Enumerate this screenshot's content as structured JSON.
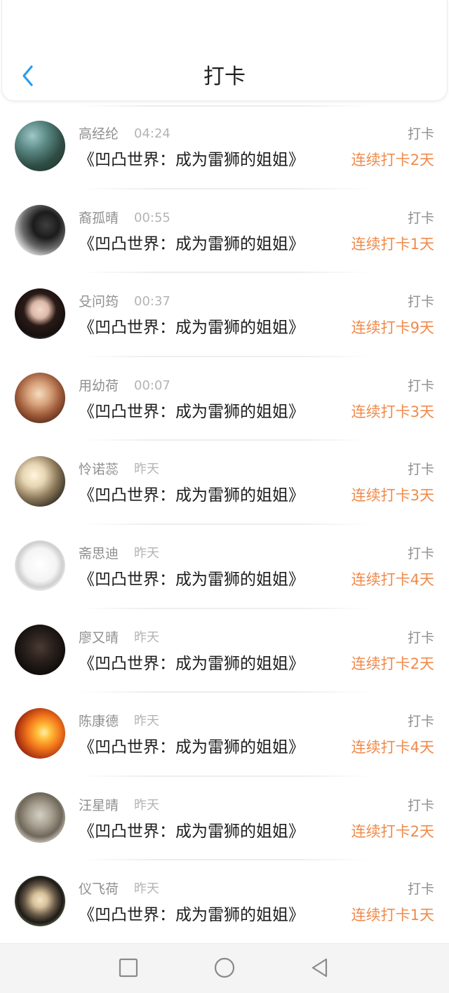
{
  "header": {
    "title": "打卡"
  },
  "checkins": [
    {
      "name": "高经纶",
      "time": "04:24",
      "book": "《凹凸世界：成为雷狮的姐姐》",
      "tag": "打卡",
      "streak": "连续打卡2天"
    },
    {
      "name": "裔孤晴",
      "time": "00:55",
      "book": "《凹凸世界：成为雷狮的姐姐》",
      "tag": "打卡",
      "streak": "连续打卡1天"
    },
    {
      "name": "殳问筠",
      "time": "00:37",
      "book": "《凹凸世界：成为雷狮的姐姐》",
      "tag": "打卡",
      "streak": "连续打卡9天"
    },
    {
      "name": "用幼荷",
      "time": "00:07",
      "book": "《凹凸世界：成为雷狮的姐姐》",
      "tag": "打卡",
      "streak": "连续打卡3天"
    },
    {
      "name": "怜诺蕊",
      "time": "昨天",
      "book": "《凹凸世界：成为雷狮的姐姐》",
      "tag": "打卡",
      "streak": "连续打卡3天"
    },
    {
      "name": "斋思迪",
      "time": "昨天",
      "book": "《凹凸世界：成为雷狮的姐姐》",
      "tag": "打卡",
      "streak": "连续打卡4天"
    },
    {
      "name": "廖又晴",
      "time": "昨天",
      "book": "《凹凸世界：成为雷狮的姐姐》",
      "tag": "打卡",
      "streak": "连续打卡2天"
    },
    {
      "name": "陈康德",
      "time": "昨天",
      "book": "《凹凸世界：成为雷狮的姐姐》",
      "tag": "打卡",
      "streak": "连续打卡4天"
    },
    {
      "name": "汪星晴",
      "time": "昨天",
      "book": "《凹凸世界：成为雷狮的姐姐》",
      "tag": "打卡",
      "streak": "连续打卡2天"
    },
    {
      "name": "仪飞荷",
      "time": "昨天",
      "book": "《凹凸世界：成为雷狮的姐姐》",
      "tag": "打卡",
      "streak": "连续打卡1天"
    }
  ],
  "icons": {
    "back": "chevron-left-icon",
    "recent_apps": "square-icon",
    "home": "circle-icon",
    "nav_back": "triangle-back-icon"
  },
  "colors": {
    "accent_blue": "#2b9cf0",
    "streak_orange": "#f08a4b",
    "text_primary": "#1d1d1d",
    "text_secondary": "#8f8f8f"
  }
}
